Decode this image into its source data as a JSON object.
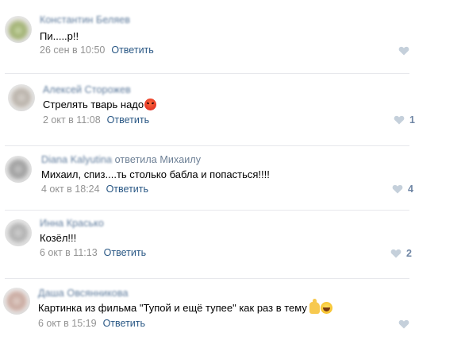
{
  "comments": [
    {
      "author": "Константин Беляев",
      "text": "Пи.....р!!",
      "date": "26 сен в 10:50",
      "reply_label": "Ответить",
      "likes": ""
    },
    {
      "author": "Алексей Сторожев",
      "text": "Стрелять тварь надо",
      "emoji": "angry-face-icon",
      "date": "2 окт в 11:08",
      "reply_label": "Ответить",
      "likes": "1"
    },
    {
      "author": "Diana Kalyutina",
      "reply_to": "ответила Михаилу",
      "text": "Михаил, спиз....ть столько бабла и попасться!!!!",
      "date": "4 окт в 18:24",
      "reply_label": "Ответить",
      "likes": "4"
    },
    {
      "author": "Инна Красько",
      "text": "Козёл!!!",
      "date": "6 окт в 11:13",
      "reply_label": "Ответить",
      "likes": "2"
    },
    {
      "author": "Даша Овсянникова",
      "text": "Картинка из фильма \"Тупой и ещё тупее\" как раз в тему",
      "emoji": "thumbs-up-and-laughing-icons",
      "date": "6 окт в 15:19",
      "reply_label": "Ответить",
      "likes": ""
    }
  ],
  "colors": {
    "author": "#42648b",
    "link": "#2a5885",
    "meta": "#939393",
    "like": "#6e85a4",
    "divider": "#e7e8ec"
  }
}
